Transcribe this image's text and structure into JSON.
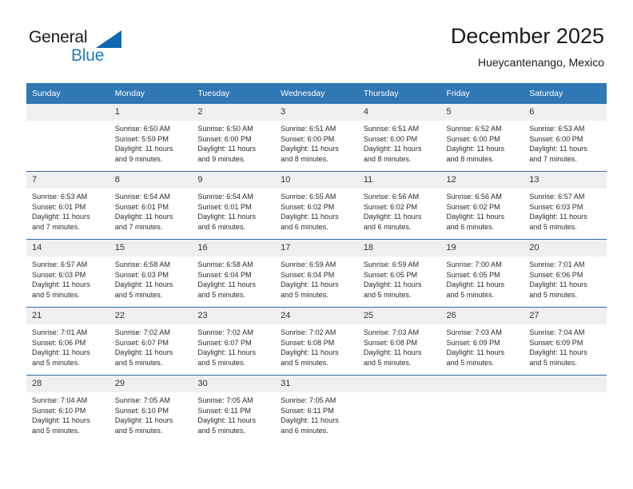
{
  "brand": {
    "name_part1": "General",
    "name_part2": "Blue",
    "accent_color": "#1267b0",
    "blue_text_color": "#1f7ac4"
  },
  "header": {
    "title": "December 2025",
    "subtitle": "Hueycantenango, Mexico"
  },
  "theme": {
    "header_row_bg": "#3077b5",
    "daynum_bg": "#efefef",
    "week_separator": "#2c6aa8",
    "cell_bg": "#ffffff",
    "text_color": "#2b2b2b"
  },
  "weekday_headers": [
    "Sunday",
    "Monday",
    "Tuesday",
    "Wednesday",
    "Thursday",
    "Friday",
    "Saturday"
  ],
  "labels": {
    "sunrise_prefix": "Sunrise:",
    "sunset_prefix": "Sunset:",
    "daylight_prefix": "Daylight:"
  },
  "weeks": [
    [
      {
        "day": "",
        "sunrise": "",
        "sunset": "",
        "daylight_line1": "",
        "daylight_line2": ""
      },
      {
        "day": "1",
        "sunrise": "Sunrise: 6:50 AM",
        "sunset": "Sunset: 5:59 PM",
        "daylight_line1": "Daylight: 11 hours",
        "daylight_line2": "and 9 minutes."
      },
      {
        "day": "2",
        "sunrise": "Sunrise: 6:50 AM",
        "sunset": "Sunset: 6:00 PM",
        "daylight_line1": "Daylight: 11 hours",
        "daylight_line2": "and 9 minutes."
      },
      {
        "day": "3",
        "sunrise": "Sunrise: 6:51 AM",
        "sunset": "Sunset: 6:00 PM",
        "daylight_line1": "Daylight: 11 hours",
        "daylight_line2": "and 8 minutes."
      },
      {
        "day": "4",
        "sunrise": "Sunrise: 6:51 AM",
        "sunset": "Sunset: 6:00 PM",
        "daylight_line1": "Daylight: 11 hours",
        "daylight_line2": "and 8 minutes."
      },
      {
        "day": "5",
        "sunrise": "Sunrise: 6:52 AM",
        "sunset": "Sunset: 6:00 PM",
        "daylight_line1": "Daylight: 11 hours",
        "daylight_line2": "and 8 minutes."
      },
      {
        "day": "6",
        "sunrise": "Sunrise: 6:53 AM",
        "sunset": "Sunset: 6:00 PM",
        "daylight_line1": "Daylight: 11 hours",
        "daylight_line2": "and 7 minutes."
      }
    ],
    [
      {
        "day": "7",
        "sunrise": "Sunrise: 6:53 AM",
        "sunset": "Sunset: 6:01 PM",
        "daylight_line1": "Daylight: 11 hours",
        "daylight_line2": "and 7 minutes."
      },
      {
        "day": "8",
        "sunrise": "Sunrise: 6:54 AM",
        "sunset": "Sunset: 6:01 PM",
        "daylight_line1": "Daylight: 11 hours",
        "daylight_line2": "and 7 minutes."
      },
      {
        "day": "9",
        "sunrise": "Sunrise: 6:54 AM",
        "sunset": "Sunset: 6:01 PM",
        "daylight_line1": "Daylight: 11 hours",
        "daylight_line2": "and 6 minutes."
      },
      {
        "day": "10",
        "sunrise": "Sunrise: 6:55 AM",
        "sunset": "Sunset: 6:02 PM",
        "daylight_line1": "Daylight: 11 hours",
        "daylight_line2": "and 6 minutes."
      },
      {
        "day": "11",
        "sunrise": "Sunrise: 6:56 AM",
        "sunset": "Sunset: 6:02 PM",
        "daylight_line1": "Daylight: 11 hours",
        "daylight_line2": "and 6 minutes."
      },
      {
        "day": "12",
        "sunrise": "Sunrise: 6:56 AM",
        "sunset": "Sunset: 6:02 PM",
        "daylight_line1": "Daylight: 11 hours",
        "daylight_line2": "and 6 minutes."
      },
      {
        "day": "13",
        "sunrise": "Sunrise: 6:57 AM",
        "sunset": "Sunset: 6:03 PM",
        "daylight_line1": "Daylight: 11 hours",
        "daylight_line2": "and 5 minutes."
      }
    ],
    [
      {
        "day": "14",
        "sunrise": "Sunrise: 6:57 AM",
        "sunset": "Sunset: 6:03 PM",
        "daylight_line1": "Daylight: 11 hours",
        "daylight_line2": "and 5 minutes."
      },
      {
        "day": "15",
        "sunrise": "Sunrise: 6:58 AM",
        "sunset": "Sunset: 6:03 PM",
        "daylight_line1": "Daylight: 11 hours",
        "daylight_line2": "and 5 minutes."
      },
      {
        "day": "16",
        "sunrise": "Sunrise: 6:58 AM",
        "sunset": "Sunset: 6:04 PM",
        "daylight_line1": "Daylight: 11 hours",
        "daylight_line2": "and 5 minutes."
      },
      {
        "day": "17",
        "sunrise": "Sunrise: 6:59 AM",
        "sunset": "Sunset: 6:04 PM",
        "daylight_line1": "Daylight: 11 hours",
        "daylight_line2": "and 5 minutes."
      },
      {
        "day": "18",
        "sunrise": "Sunrise: 6:59 AM",
        "sunset": "Sunset: 6:05 PM",
        "daylight_line1": "Daylight: 11 hours",
        "daylight_line2": "and 5 minutes."
      },
      {
        "day": "19",
        "sunrise": "Sunrise: 7:00 AM",
        "sunset": "Sunset: 6:05 PM",
        "daylight_line1": "Daylight: 11 hours",
        "daylight_line2": "and 5 minutes."
      },
      {
        "day": "20",
        "sunrise": "Sunrise: 7:01 AM",
        "sunset": "Sunset: 6:06 PM",
        "daylight_line1": "Daylight: 11 hours",
        "daylight_line2": "and 5 minutes."
      }
    ],
    [
      {
        "day": "21",
        "sunrise": "Sunrise: 7:01 AM",
        "sunset": "Sunset: 6:06 PM",
        "daylight_line1": "Daylight: 11 hours",
        "daylight_line2": "and 5 minutes."
      },
      {
        "day": "22",
        "sunrise": "Sunrise: 7:02 AM",
        "sunset": "Sunset: 6:07 PM",
        "daylight_line1": "Daylight: 11 hours",
        "daylight_line2": "and 5 minutes."
      },
      {
        "day": "23",
        "sunrise": "Sunrise: 7:02 AM",
        "sunset": "Sunset: 6:07 PM",
        "daylight_line1": "Daylight: 11 hours",
        "daylight_line2": "and 5 minutes."
      },
      {
        "day": "24",
        "sunrise": "Sunrise: 7:02 AM",
        "sunset": "Sunset: 6:08 PM",
        "daylight_line1": "Daylight: 11 hours",
        "daylight_line2": "and 5 minutes."
      },
      {
        "day": "25",
        "sunrise": "Sunrise: 7:03 AM",
        "sunset": "Sunset: 6:08 PM",
        "daylight_line1": "Daylight: 11 hours",
        "daylight_line2": "and 5 minutes."
      },
      {
        "day": "26",
        "sunrise": "Sunrise: 7:03 AM",
        "sunset": "Sunset: 6:09 PM",
        "daylight_line1": "Daylight: 11 hours",
        "daylight_line2": "and 5 minutes."
      },
      {
        "day": "27",
        "sunrise": "Sunrise: 7:04 AM",
        "sunset": "Sunset: 6:09 PM",
        "daylight_line1": "Daylight: 11 hours",
        "daylight_line2": "and 5 minutes."
      }
    ],
    [
      {
        "day": "28",
        "sunrise": "Sunrise: 7:04 AM",
        "sunset": "Sunset: 6:10 PM",
        "daylight_line1": "Daylight: 11 hours",
        "daylight_line2": "and 5 minutes."
      },
      {
        "day": "29",
        "sunrise": "Sunrise: 7:05 AM",
        "sunset": "Sunset: 6:10 PM",
        "daylight_line1": "Daylight: 11 hours",
        "daylight_line2": "and 5 minutes."
      },
      {
        "day": "30",
        "sunrise": "Sunrise: 7:05 AM",
        "sunset": "Sunset: 6:11 PM",
        "daylight_line1": "Daylight: 11 hours",
        "daylight_line2": "and 5 minutes."
      },
      {
        "day": "31",
        "sunrise": "Sunrise: 7:05 AM",
        "sunset": "Sunset: 6:11 PM",
        "daylight_line1": "Daylight: 11 hours",
        "daylight_line2": "and 6 minutes."
      },
      {
        "day": "",
        "sunrise": "",
        "sunset": "",
        "daylight_line1": "",
        "daylight_line2": ""
      },
      {
        "day": "",
        "sunrise": "",
        "sunset": "",
        "daylight_line1": "",
        "daylight_line2": ""
      },
      {
        "day": "",
        "sunrise": "",
        "sunset": "",
        "daylight_line1": "",
        "daylight_line2": ""
      }
    ]
  ]
}
